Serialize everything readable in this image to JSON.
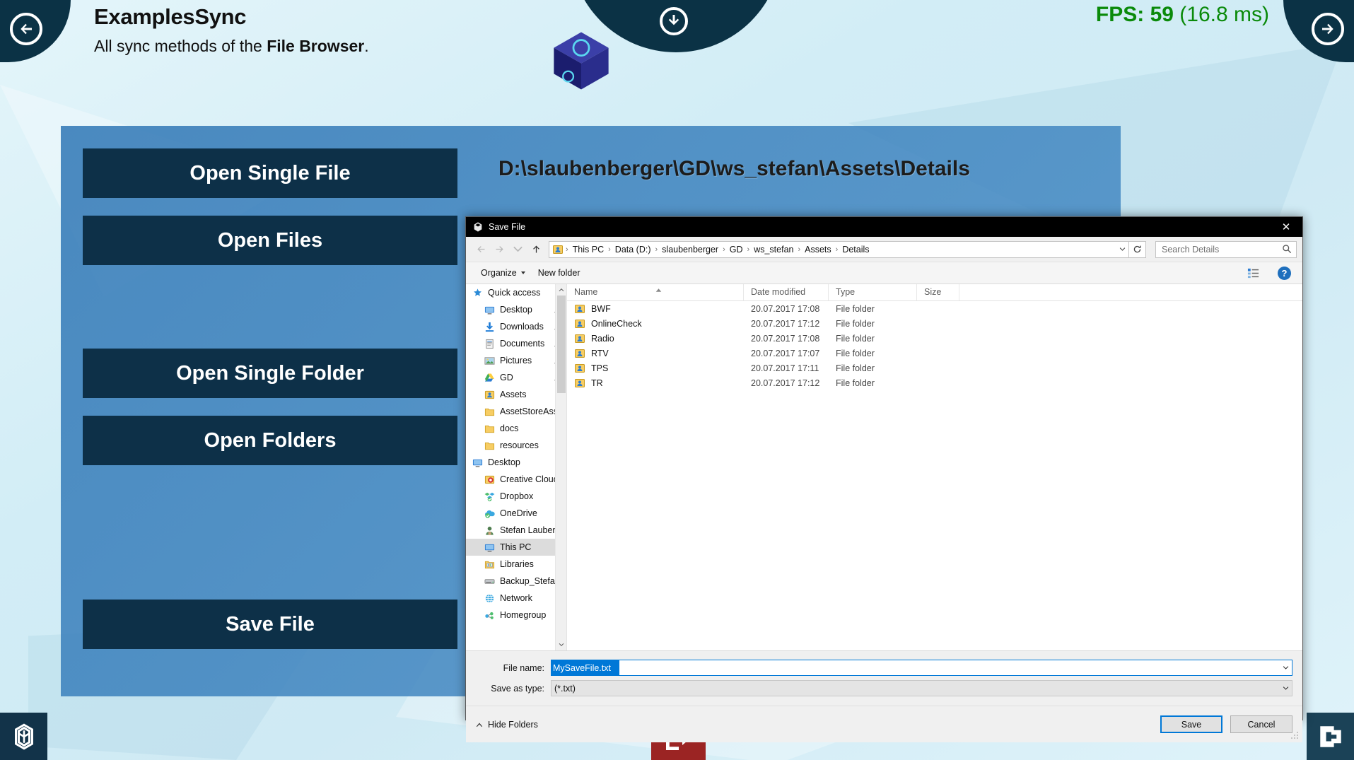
{
  "app": {
    "title": "ExamplesSync",
    "subtitle_pre": "All sync methods of the ",
    "subtitle_bold": "File Browser",
    "subtitle_post": ".",
    "fps_label": "FPS: 59",
    "fps_ms": "(16.8 ms)",
    "fps_color": "#0a8a0a",
    "accent_dark": "#0b3245",
    "panel_blue": "#3d7cb8",
    "button_dark": "#0d3048"
  },
  "nav": {
    "prev_icon": "arrow-left-circle-icon",
    "next_icon": "arrow-right-circle-icon",
    "download_icon": "arrow-down-circle-icon",
    "unity_icon": "unity-logo-icon",
    "corner_icon": "c-logo-icon",
    "exit_icon": "exit-door-icon"
  },
  "main": {
    "buttons": [
      {
        "label": "Open Single File"
      },
      {
        "label": "Open Files"
      },
      {
        "label": "Open Single Folder"
      },
      {
        "label": "Open Folders"
      },
      {
        "label": "Save File"
      }
    ],
    "path_display": "D:\\slaubenberger\\GD\\ws_stefan\\Assets\\Details"
  },
  "dialog": {
    "title": "Save File",
    "title_icon": "unity-app-icon",
    "close_label": "✕",
    "nav": {
      "back_icon": "arrow-back-icon",
      "forward_icon": "arrow-forward-icon",
      "recent_icon": "chevron-down-icon",
      "up_icon": "arrow-up-icon"
    },
    "breadcrumb": {
      "root_icon": "folder-user-icon",
      "items": [
        "This PC",
        "Data (D:)",
        "slaubenberger",
        "GD",
        "ws_stefan",
        "Assets",
        "Details"
      ],
      "separator": "›",
      "dropdown_icon": "chevron-down-icon",
      "refresh_icon": "refresh-icon"
    },
    "search": {
      "placeholder": "Search Details",
      "value": "",
      "icon": "search-icon"
    },
    "command_bar": {
      "organize_label": "Organize",
      "organize_caret": "chevron-down-icon",
      "new_folder_label": "New folder",
      "view_icon": "view-options-icon",
      "view_caret": "chevron-down-icon",
      "help_label": "?",
      "help_icon": "help-icon"
    },
    "tree": [
      {
        "label": "Quick access",
        "icon": "star-icon",
        "indent": false,
        "pin": false,
        "selected": false
      },
      {
        "label": "Desktop",
        "icon": "desktop-icon",
        "indent": true,
        "pin": true,
        "selected": false
      },
      {
        "label": "Downloads",
        "icon": "download-arrow-icon",
        "indent": true,
        "pin": true,
        "selected": false
      },
      {
        "label": "Documents",
        "icon": "documents-icon",
        "indent": true,
        "pin": true,
        "selected": false
      },
      {
        "label": "Pictures",
        "icon": "pictures-icon",
        "indent": true,
        "pin": true,
        "selected": false
      },
      {
        "label": "GD",
        "icon": "google-drive-icon",
        "indent": true,
        "pin": true,
        "selected": false
      },
      {
        "label": "Assets",
        "icon": "folder-user-icon",
        "indent": true,
        "pin": false,
        "selected": false
      },
      {
        "label": "AssetStoreAssetE",
        "icon": "folder-icon",
        "indent": true,
        "pin": false,
        "selected": false
      },
      {
        "label": "docs",
        "icon": "folder-icon",
        "indent": true,
        "pin": false,
        "selected": false
      },
      {
        "label": "resources",
        "icon": "folder-icon",
        "indent": true,
        "pin": false,
        "selected": false
      },
      {
        "label": "Desktop",
        "icon": "desktop-icon",
        "indent": false,
        "pin": false,
        "selected": false
      },
      {
        "label": "Creative Cloud F",
        "icon": "creative-cloud-icon",
        "indent": true,
        "pin": false,
        "selected": false
      },
      {
        "label": "Dropbox",
        "icon": "dropbox-icon",
        "indent": true,
        "pin": false,
        "selected": false
      },
      {
        "label": "OneDrive",
        "icon": "onedrive-icon",
        "indent": true,
        "pin": false,
        "selected": false
      },
      {
        "label": "Stefan Laubenbe",
        "icon": "user-icon",
        "indent": true,
        "pin": false,
        "selected": false
      },
      {
        "label": "This PC",
        "icon": "this-pc-icon",
        "indent": true,
        "pin": false,
        "selected": true
      },
      {
        "label": "Libraries",
        "icon": "libraries-icon",
        "indent": true,
        "pin": false,
        "selected": false
      },
      {
        "label": "Backup_Stefan_F",
        "icon": "drive-icon",
        "indent": true,
        "pin": false,
        "selected": false
      },
      {
        "label": "Network",
        "icon": "network-icon",
        "indent": true,
        "pin": false,
        "selected": false
      },
      {
        "label": "Homegroup",
        "icon": "homegroup-icon",
        "indent": true,
        "pin": false,
        "selected": false
      }
    ],
    "columns": [
      "Name",
      "Date modified",
      "Type",
      "Size"
    ],
    "sorted_column": "Name",
    "sort_direction": "ascending",
    "files": [
      {
        "name": "BWF",
        "date": "20.07.2017 17:08",
        "type": "File folder",
        "size": "",
        "icon": "folder-user-icon"
      },
      {
        "name": "OnlineCheck",
        "date": "20.07.2017 17:12",
        "type": "File folder",
        "size": "",
        "icon": "folder-user-icon"
      },
      {
        "name": "Radio",
        "date": "20.07.2017 17:08",
        "type": "File folder",
        "size": "",
        "icon": "folder-user-icon"
      },
      {
        "name": "RTV",
        "date": "20.07.2017 17:07",
        "type": "File folder",
        "size": "",
        "icon": "folder-user-icon"
      },
      {
        "name": "TPS",
        "date": "20.07.2017 17:11",
        "type": "File folder",
        "size": "",
        "icon": "folder-user-icon"
      },
      {
        "name": "TR",
        "date": "20.07.2017 17:12",
        "type": "File folder",
        "size": "",
        "icon": "folder-user-icon"
      }
    ],
    "form": {
      "filename_label": "File name:",
      "filename_value": "MySaveFile.txt",
      "savetype_label": "Save as type:",
      "savetype_value": "(*.txt)",
      "dropdown_icon": "chevron-down-icon"
    },
    "footer": {
      "hide_folders_label": "Hide Folders",
      "hide_folders_icon": "chevron-up-icon",
      "save_label": "Save",
      "cancel_label": "Cancel"
    }
  }
}
